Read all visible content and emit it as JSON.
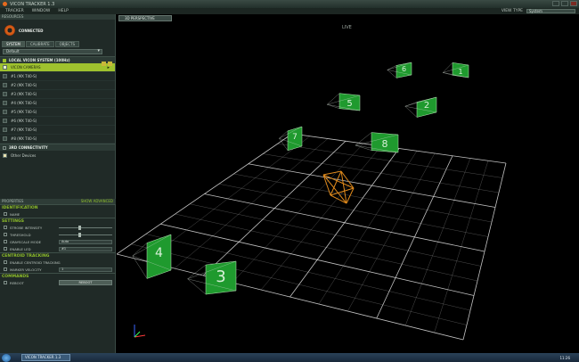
{
  "window": {
    "title": "VICON TRACKER 1.3"
  },
  "menu": {
    "items": [
      "TRACKER",
      "WINDOW",
      "HELP"
    ],
    "view_type_label": "VIEW TYPE",
    "view_type_value": "System"
  },
  "panel": {
    "header": "RESOURCES",
    "status": "CONNECTED",
    "tabs": [
      "SYSTEM",
      "CALIBRATE",
      "OBJECTS"
    ],
    "dropdown": "Default",
    "group_main": "LOCAL VICON SYSTEM (100Hz)",
    "selected_row": "VICON CAMERAS",
    "cameras": [
      "#1 (MX T40-S)",
      "#2 (MX T40-S)",
      "#3 (MX T40-S)",
      "#4 (MX T40-S)",
      "#5 (MX T40-S)",
      "#6 (MX T40-S)",
      "#7 (MX T40-S)",
      "#8 (MX T40-S)"
    ],
    "group_secondary": "3RD CONNECTIVITY",
    "other_devices": "Other Devices"
  },
  "props": {
    "header": "PROPERTIES",
    "header_right": "SHOW ADVANCED",
    "sections": {
      "identification": "IDENTIFICATION",
      "name_label": "NAME",
      "settings": "SETTINGS",
      "strobe": "STROBE INTENSITY",
      "threshold": "THRESHOLD",
      "grayscale": "GRAYSCALE MODE",
      "grayscale_value": "Auto",
      "enable_led": "ENABLE LED",
      "led_value": "#1",
      "centroid": "CENTROID TRACKING",
      "enable_centroid": "ENABLE CENTROID TRACKING",
      "marker_velocity": "MARKER VELOCITY",
      "marker_velocity_value": "1",
      "commands": "COMMANDS",
      "reboot": "REBOOT",
      "reboot_button": "REBOOT"
    }
  },
  "viewport": {
    "tab_label": "3D PERSPECTIVE",
    "mode_label": "LIVE",
    "camera_labels": [
      "1",
      "2",
      "3",
      "4",
      "5",
      "6",
      "7",
      "8"
    ]
  },
  "taskbar": {
    "task": "VICON TRACKER 1.3",
    "clock": "11:26"
  },
  "colors": {
    "accent": "#9fc22e",
    "camera": "#1f9a2e",
    "object": "#e08a1c",
    "grid": "#d8d8d8"
  }
}
